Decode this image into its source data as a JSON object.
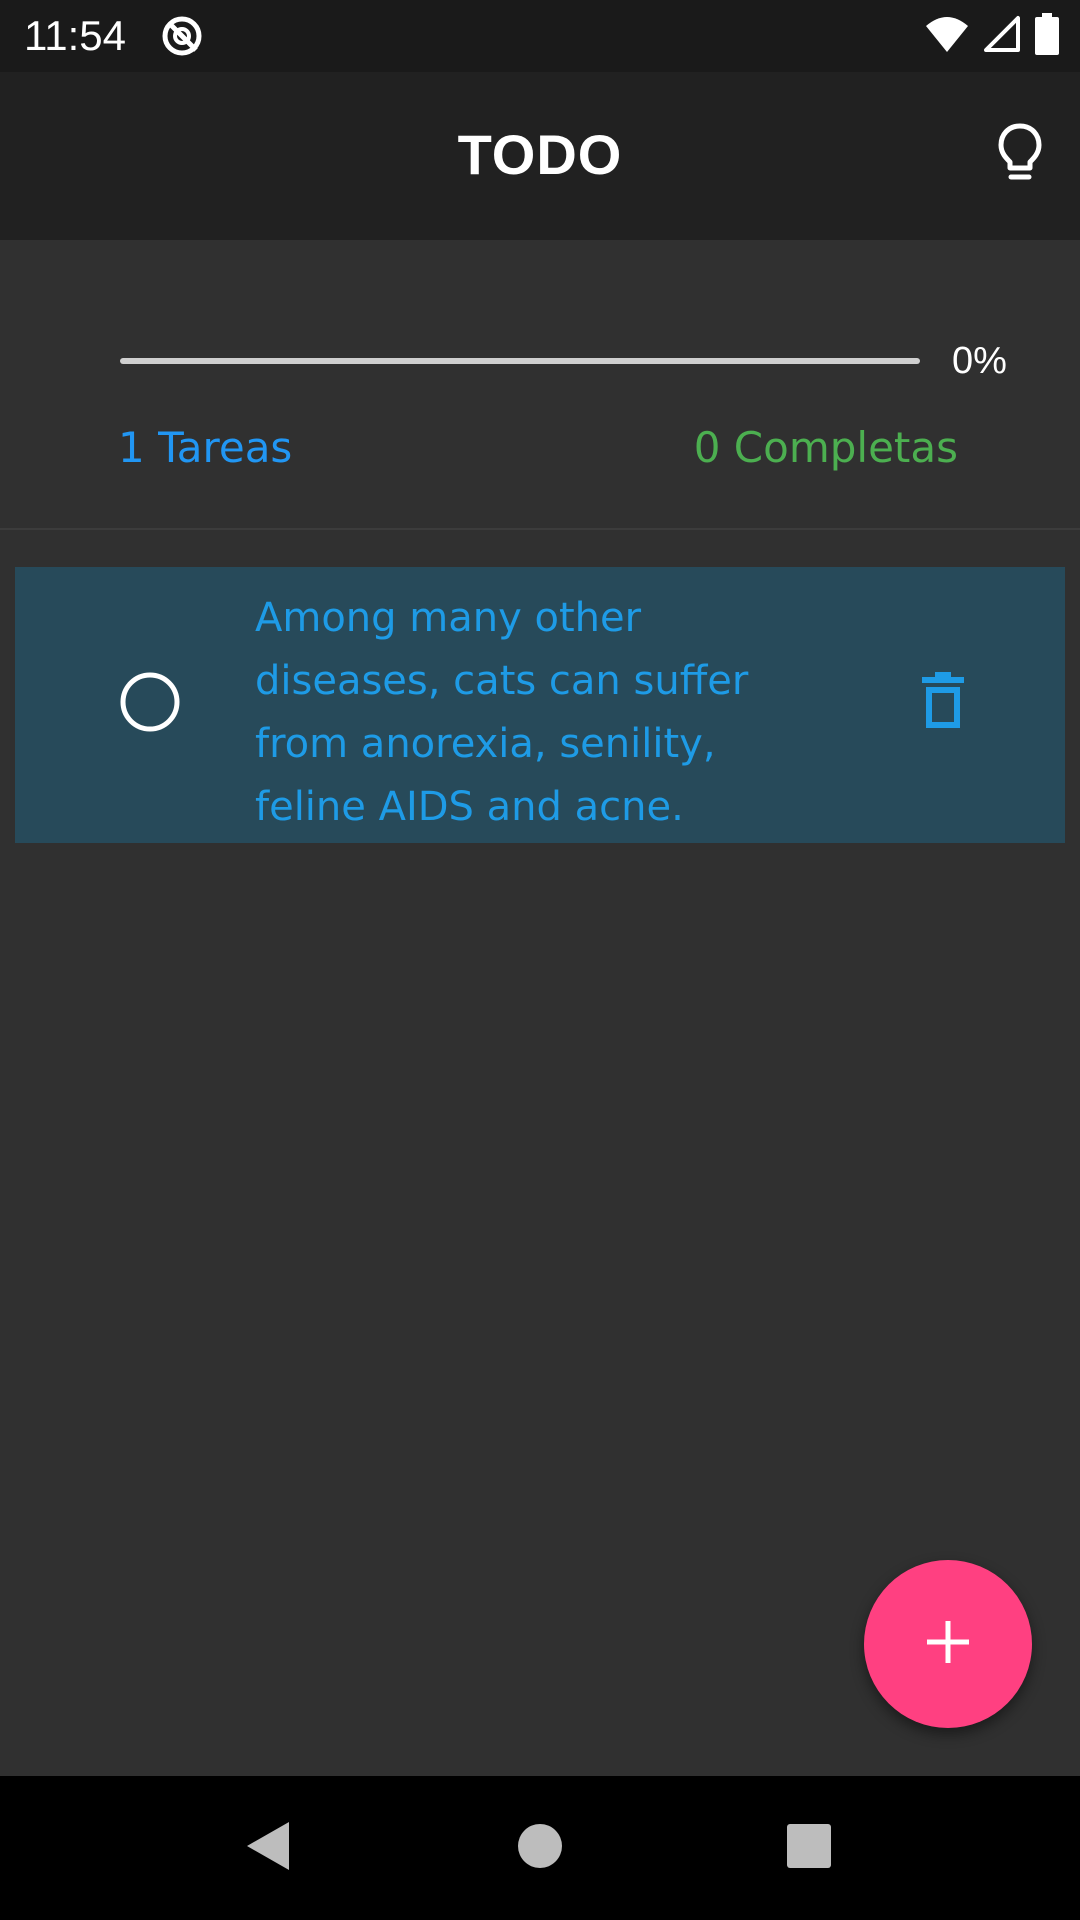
{
  "status_bar": {
    "time": "11:54",
    "icons": [
      "data-saver-icon",
      "wifi-icon",
      "cellular-signal-icon",
      "battery-icon"
    ]
  },
  "app_bar": {
    "title": "TODO",
    "action_icon": "lightbulb-icon"
  },
  "progress": {
    "percent_label": "0%",
    "fraction": 0,
    "tasks_label": "1 Tareas",
    "completed_label": "0 Completas"
  },
  "tasks": [
    {
      "text": "Among many other diseases, cats can suffer from anorexia, senility, feline AIDS and acne.",
      "completed": false,
      "check_icon": "circle-outline-icon",
      "delete_icon": "trash-icon"
    }
  ],
  "fab": {
    "icon": "plus-icon"
  },
  "nav_bar": {
    "icons": [
      "back-icon",
      "home-icon",
      "recents-icon"
    ]
  },
  "colors": {
    "background": "#303030",
    "app_bar": "#212121",
    "accent_blue": "#2196f3",
    "accent_green": "#4caf50",
    "fab": "#ff4081",
    "task_card": "#274a5a"
  }
}
